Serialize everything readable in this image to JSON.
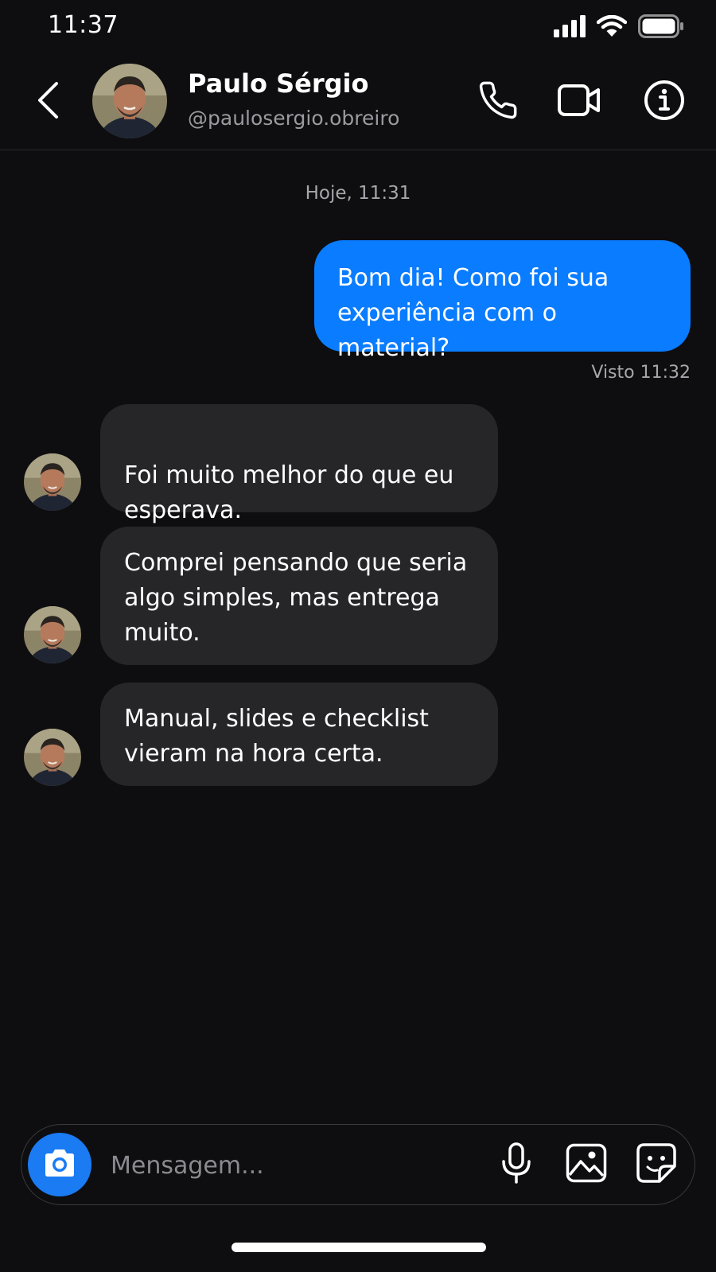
{
  "status_bar": {
    "time": "11:37",
    "icons": [
      "signal-icon",
      "wifi-icon",
      "battery-icon"
    ]
  },
  "header": {
    "back_icon": "chevron-left-icon",
    "contact_name": "Paulo Sérgio",
    "contact_handle": "@paulosergio.obreiro",
    "actions": [
      "phone-icon",
      "video-camera-icon",
      "info-icon"
    ]
  },
  "chat": {
    "date_label": "Hoje, 11:31",
    "outgoing": {
      "text": "Bom dia! Como foi sua\nexperiência com o material?",
      "status": "Visto 11:32"
    },
    "incoming": [
      {
        "text": "Foi muito melhor do que eu\nesperava.",
        "stars": "⭐⭐⭐⭐⭐"
      },
      {
        "text": "Comprei pensando que seria\nalgo simples, mas entrega\nmuito."
      },
      {
        "text": "Manual, slides e checklist\nvieram na hora certa."
      }
    ]
  },
  "composer": {
    "placeholder": "Mensagem...",
    "icons": [
      "camera-icon",
      "microphone-icon",
      "gallery-icon",
      "sticker-icon"
    ]
  },
  "colors": {
    "background": "#0e0e10",
    "outgoing_bubble": "#0a7cff",
    "incoming_bubble": "#262628",
    "camera_button": "#1a7bf2",
    "secondary_text": "#9a9aa0"
  }
}
